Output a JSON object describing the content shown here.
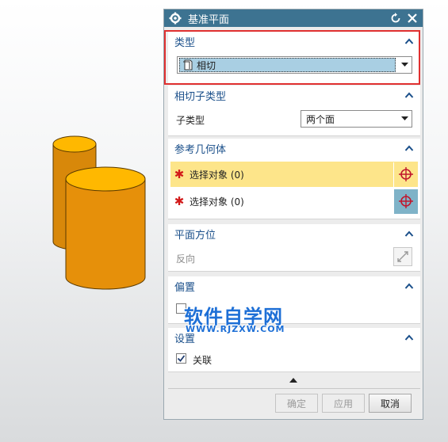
{
  "dialog": {
    "title": "基准平面",
    "icon": "gear-icon",
    "reset_icon": "reset-icon",
    "close_icon": "close-icon"
  },
  "type_group": {
    "header": "类型",
    "selected": "相切",
    "highlight_color": "#e03030"
  },
  "tangent_subtype_group": {
    "header": "相切子类型",
    "subtype_label": "子类型",
    "subtype_value": "两个面"
  },
  "reference_geometry_group": {
    "header": "参考几何体",
    "rows": [
      {
        "label": "选择对象 (0)"
      },
      {
        "label": "选择对象 (0)"
      }
    ]
  },
  "plane_orientation_group": {
    "header": "平面方位",
    "reverse_label": "反向"
  },
  "offset_group": {
    "header": "偏置"
  },
  "settings_group": {
    "header": "设置",
    "associative_label": "关联",
    "associative_checked": true
  },
  "buttons": {
    "ok": "确定",
    "apply": "应用",
    "cancel": "取消"
  },
  "watermark": {
    "text": "软件自学网",
    "url": "WWW.RJZXW.COM"
  },
  "colors": {
    "titlebar": "#3d7391",
    "header_text": "#1a4f8a",
    "selected_row": "#fde58a",
    "selection_button": "#7fb3c8",
    "cylinder": "#e6900a"
  }
}
